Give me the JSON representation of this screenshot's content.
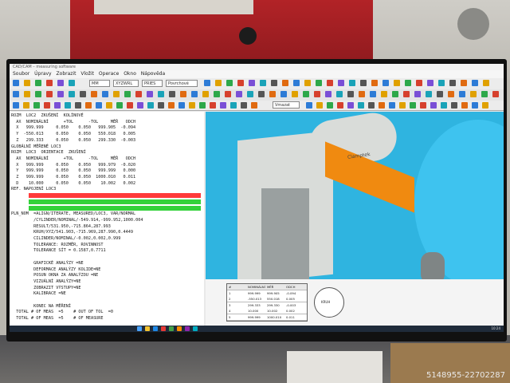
{
  "app": {
    "title": "CAD/CAM – measuring software",
    "menu": [
      "Soubor",
      "Úpravy",
      "Zobrazit",
      "Vložit",
      "Operace",
      "Okno",
      "Nápověda"
    ],
    "fields": [
      "MM",
      "XYZWRL",
      "PRIES",
      "Povrchové"
    ],
    "view_field": "Vmazat"
  },
  "report_lines": [
    "ROZM  LOC2  ZKUŠENÍ  KOLÍNOVÉ",
    "  AX  NOMINÁLNÍ      +TOL      -TOL     MĚŘ   ODCH",
    "  X   999.999     0.050    0.050   999.905  -0.094",
    "  Y  -550.013     0.050    0.050   550.018   0.005",
    "  Z   299.333     0.050    0.050   299.330  -0.003",
    "GLOBÁLNÍ MĚŘENÉ LOC3",
    "ROZM  LOC3  ORIENTACE  ZKUŠENÍ",
    "  AX  NOMINÁLNÍ      +TOL      -TOL     MĚŘ   ODCH",
    "  X   999.999     0.050    0.050   999.979  -0.020",
    "  Y   999.999     0.050    0.050   999.999   0.000",
    "  Z   999.999     0.050    0.050  1000.010   0.011",
    "  D    10.000     0.050    0.050    10.002   0.002",
    "REF. NAPOJENÍ LOC3",
    "",
    "",
    "",
    "PLN_NOM  =ALIGN/ITERATE, MEASURED/LOC3, VAR/NORMAL",
    "         /CYLINDER/NOMINAL/-549.914,-999.952,1000.004",
    "         RESULT/531.950,-715.864,287.993",
    "         KRUH/XYZ/541.903,-715.969,287.990,0.4449",
    "         CILINDER/NOMINAL/-0.002,0.002,0.999",
    "         TOLERANCE: ROZMĚR, ROVINNOST",
    "         TOLERANCE SÍT = 0.1587,0.7711",
    "",
    "         GRAFICKÉ ANALÝZY =NE",
    "         DEFORMACE ANALÝZY KOLIDE=NE",
    "         POSUN OKNA ZA ANALÝZOU =NE",
    "         VIZUÁLNÍ ANALÝZY=NE",
    "         ZOBRAZIT VÝSTUPY=NE",
    "         KALIBRACE =NE",
    "",
    "         KONEC NA MĚŘENÍ",
    "  TOTAL # OF MEAS  =5    # OUT OF TOL  =0",
    "  TOTAL # OF MEAS  =5    # OF MEASURE"
  ],
  "viewport": {
    "clamp_label": "Clamptek",
    "colors": {
      "sky": "#2fb4e0",
      "part": "#f08a10",
      "fixture": "#d9dcd9"
    }
  },
  "bottom_table": {
    "headers": [
      "#",
      "NOMINÁLNÍ",
      "MĚŘ",
      "ODCH"
    ],
    "rows": [
      [
        "1",
        "999.999",
        "999.905",
        "-0.094"
      ],
      [
        "2",
        "-550.013",
        "550.018",
        "0.005"
      ],
      [
        "3",
        "299.333",
        "299.330",
        "-0.003"
      ],
      [
        "4",
        "10.000",
        "10.002",
        "0.002"
      ],
      [
        "5",
        "999.999",
        "1000.010",
        "0.011"
      ]
    ],
    "diagram_label": "KRUH"
  },
  "taskbar": {
    "time": "10:24"
  },
  "watermark_id": "5148955-22702287"
}
